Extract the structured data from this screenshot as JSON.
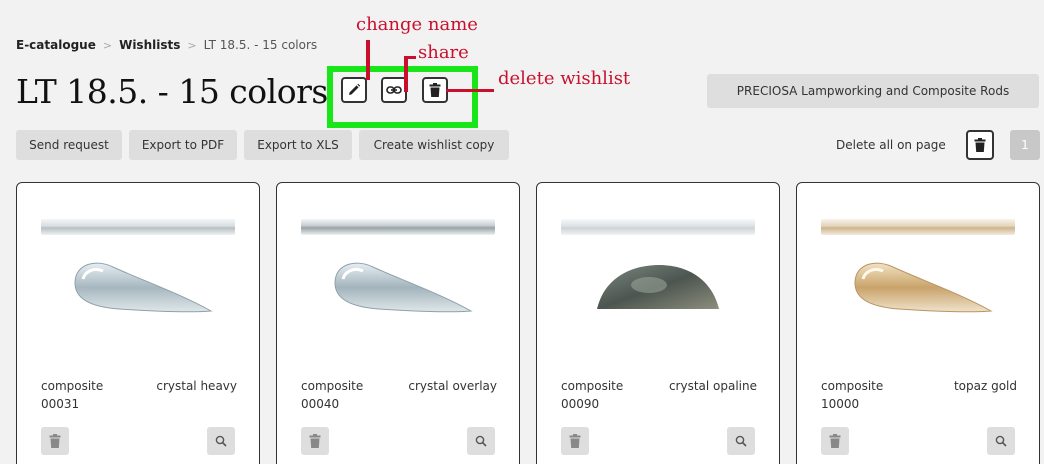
{
  "breadcrumb": {
    "items": [
      "E-catalogue",
      "Wishlists",
      "LT 18.5. - 15 colors"
    ],
    "separator": ">"
  },
  "page_title": "LT 18.5. - 15 colors",
  "annotations": {
    "change_name": "change name",
    "share": "share",
    "delete_wishlist": "delete wishlist",
    "highlight_color": "#19e619",
    "annotation_color": "#c8102e"
  },
  "collection_button": "PRECIOSA Lampworking and Composite Rods",
  "toolbar": {
    "send_request": "Send request",
    "export_pdf": "Export to PDF",
    "export_xls": "Export to XLS",
    "create_copy": "Create wishlist copy",
    "delete_all_label": "Delete all on page",
    "page_number": "1"
  },
  "products": [
    {
      "type": "composite",
      "code": "00031",
      "color": "crystal heavy",
      "shape": "teardrop-clear"
    },
    {
      "type": "composite",
      "code": "00040",
      "color": "crystal overlay",
      "shape": "teardrop-clear"
    },
    {
      "type": "composite",
      "code": "00090",
      "color": "crystal opaline",
      "shape": "half-disc-dark"
    },
    {
      "type": "composite",
      "code": "10000",
      "color": "topaz gold",
      "shape": "teardrop-topaz"
    }
  ],
  "icons": {
    "edit": "pencil-icon",
    "share": "link-icon",
    "delete": "trash-icon",
    "zoom": "magnifier-icon"
  }
}
